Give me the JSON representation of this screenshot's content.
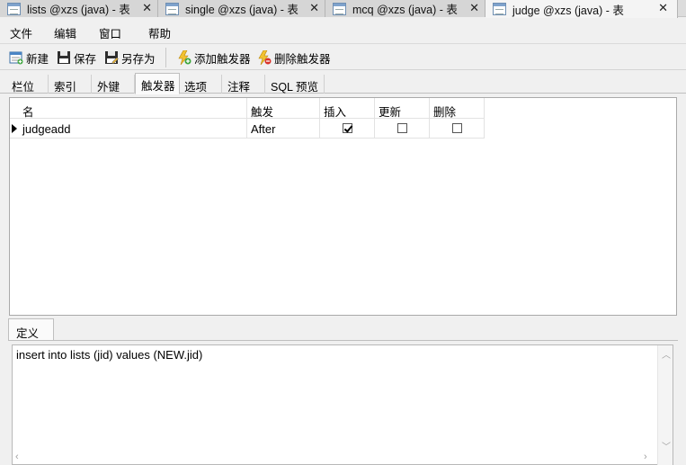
{
  "doc_tabs": [
    {
      "label": "lists @xzs (java) - 表"
    },
    {
      "label": "single @xzs (java) - 表"
    },
    {
      "label": "mcq @xzs (java) - 表"
    },
    {
      "label": "judge @xzs (java) - 表"
    }
  ],
  "menu": {
    "file": "文件",
    "edit": "编辑",
    "window": "窗口",
    "help": "帮助"
  },
  "toolbar": {
    "new": "新建",
    "save": "保存",
    "save_as": "另存为",
    "add_trigger": "添加触发器",
    "delete_trigger": "删除触发器"
  },
  "subtabs": [
    "栏位",
    "索引",
    "外键",
    "触发器",
    "选项",
    "注释",
    "SQL 预览"
  ],
  "grid": {
    "columns": [
      "名",
      "触发",
      "插入",
      "更新",
      "删除"
    ],
    "rows": [
      {
        "name": "judgeadd",
        "fires": "After",
        "insert": true,
        "update": false,
        "delete": false
      }
    ]
  },
  "definition": {
    "tab_label": "定义",
    "text": "insert into lists (jid) values (NEW.jid)"
  },
  "colors": {
    "active_tab_bg": "#f4f4f4",
    "grid_bg": "#ffffff"
  }
}
